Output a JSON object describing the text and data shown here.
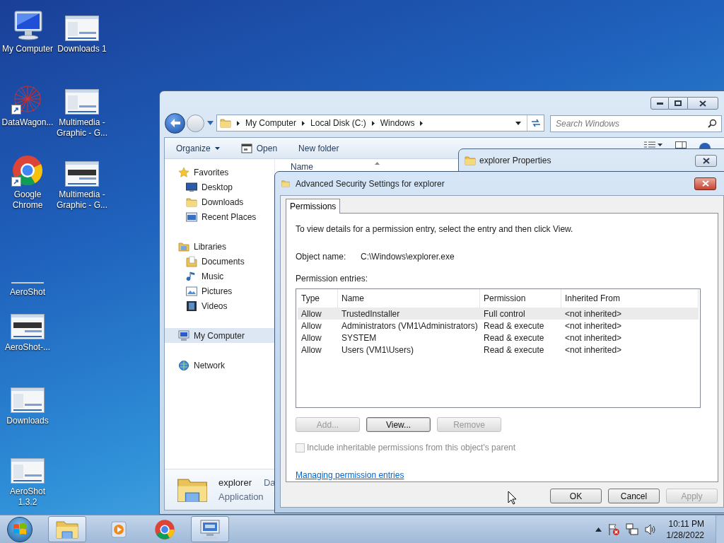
{
  "desktop": {
    "column_1": [
      {
        "label": "My Computer",
        "kind": "computer",
        "shortcut": false
      },
      {
        "label": "DataWagon...",
        "kind": "network-art",
        "shortcut": true
      },
      {
        "label": "Google Chrome",
        "kind": "chrome",
        "shortcut": true
      },
      {
        "label": "AeroShot",
        "kind": "line",
        "shortcut": false
      },
      {
        "label": "AeroShot-...",
        "kind": "thumbnail-dark",
        "shortcut": false
      },
      {
        "label": "Downloads",
        "kind": "thumbnail",
        "shortcut": false
      },
      {
        "label": "AeroShot 1.3.2",
        "kind": "thumbnail",
        "shortcut": false
      }
    ],
    "column_2": [
      {
        "label": "Downloads 1",
        "kind": "thumbnail",
        "shortcut": false
      },
      {
        "label": "Multimedia - Graphic - G...",
        "kind": "thumbnail",
        "shortcut": false
      },
      {
        "label": "Multimedia - Graphic - G...",
        "kind": "thumbnail-dark",
        "shortcut": false
      }
    ]
  },
  "explorer": {
    "address": [
      "My Computer",
      "Local Disk (C:)",
      "Windows"
    ],
    "search_placeholder": "Search Windows",
    "toolbar": [
      {
        "label": "Organize",
        "kind": "menu"
      },
      {
        "label": "Open",
        "kind": "open"
      },
      {
        "label": "New folder",
        "kind": "plain"
      }
    ],
    "nav_groups": [
      {
        "label": "Favorites",
        "kind": "star",
        "selected": false,
        "children": [
          {
            "label": "Desktop",
            "kind": "desktop",
            "selected": false
          },
          {
            "label": "Downloads",
            "kind": "folder",
            "selected": false
          },
          {
            "label": "Recent Places",
            "kind": "recent",
            "selected": false
          }
        ]
      },
      {
        "label": "Libraries",
        "kind": "library",
        "selected": false,
        "children": [
          {
            "label": "Documents",
            "kind": "documents",
            "selected": false
          },
          {
            "label": "Music",
            "kind": "music",
            "selected": false
          },
          {
            "label": "Pictures",
            "kind": "pictures",
            "selected": false
          },
          {
            "label": "Videos",
            "kind": "videos",
            "selected": false
          }
        ]
      },
      {
        "label": "My Computer",
        "kind": "computer",
        "selected": true
      },
      {
        "label": "Network",
        "kind": "network",
        "selected": false
      }
    ],
    "column_header": "Name",
    "details": {
      "name": "explorer",
      "extra": "Da",
      "type": "Application"
    }
  },
  "properties_window": {
    "title": "explorer Properties"
  },
  "security_dialog": {
    "title": "Advanced Security Settings for explorer",
    "tabs": [
      {
        "label": "Permissions",
        "selected": true
      }
    ],
    "instruction": "To view details for a permission entry, select the entry and then click View.",
    "object_name_label": "Object name:",
    "object_name": "C:\\Windows\\explorer.exe",
    "entries_label": "Permission entries:",
    "columns": [
      "Type",
      "Name",
      "Permission",
      "Inherited From"
    ],
    "rows": [
      {
        "type": "Allow",
        "name": "TrustedInstaller",
        "permission": "Full control",
        "inherited": "<not inherited>",
        "selected": true
      },
      {
        "type": "Allow",
        "name": "Administrators (VM1\\Administrators)",
        "permission": "Read & execute",
        "inherited": "<not inherited>",
        "selected": false
      },
      {
        "type": "Allow",
        "name": "SYSTEM",
        "permission": "Read & execute",
        "inherited": "<not inherited>",
        "selected": false
      },
      {
        "type": "Allow",
        "name": "Users (VM1\\Users)",
        "permission": "Read & execute",
        "inherited": "<not inherited>",
        "selected": false
      }
    ],
    "entry_buttons": [
      {
        "label": "Add...",
        "disabled": true,
        "focused": false
      },
      {
        "label": "View...",
        "disabled": false,
        "focused": true
      },
      {
        "label": "Remove",
        "disabled": true,
        "focused": false
      }
    ],
    "inherit_checkbox": {
      "label": "Include inheritable permissions from this object's parent",
      "checked": false,
      "disabled": true
    },
    "link": "Managing permission entries",
    "footer_buttons": [
      {
        "label": "OK",
        "disabled": false
      },
      {
        "label": "Cancel",
        "disabled": false
      },
      {
        "label": "Apply",
        "disabled": true
      }
    ]
  },
  "taskbar": {
    "items": [
      {
        "kind": "explorer",
        "active": true
      },
      {
        "kind": "media",
        "active": false
      },
      {
        "kind": "chrome",
        "active": false
      },
      {
        "kind": "remote",
        "active": true
      }
    ],
    "tray": [
      {
        "kind": "up"
      },
      {
        "kind": "flag"
      },
      {
        "kind": "network"
      },
      {
        "kind": "volume"
      }
    ],
    "time": "10:11 PM",
    "date": "1/28/2022"
  }
}
